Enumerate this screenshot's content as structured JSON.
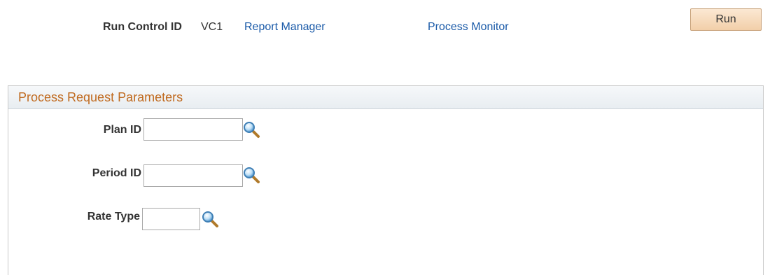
{
  "run_control": {
    "label": "Run Control ID",
    "value": "VC1",
    "report_manager_link": "Report Manager",
    "process_monitor_link": "Process Monitor",
    "run_button": "Run"
  },
  "group": {
    "title": "Process Request Parameters",
    "fields": [
      {
        "label": "Plan ID",
        "value": "",
        "lookup_icon": "search-icon"
      },
      {
        "label": "Period ID",
        "value": "",
        "lookup_icon": "search-icon"
      },
      {
        "label": "Rate Type",
        "value": "",
        "lookup_icon": "search-icon"
      }
    ]
  },
  "colors": {
    "link": "#1a5aa8",
    "group_title": "#c06a1f",
    "button_bg": "#f2cfa9"
  }
}
